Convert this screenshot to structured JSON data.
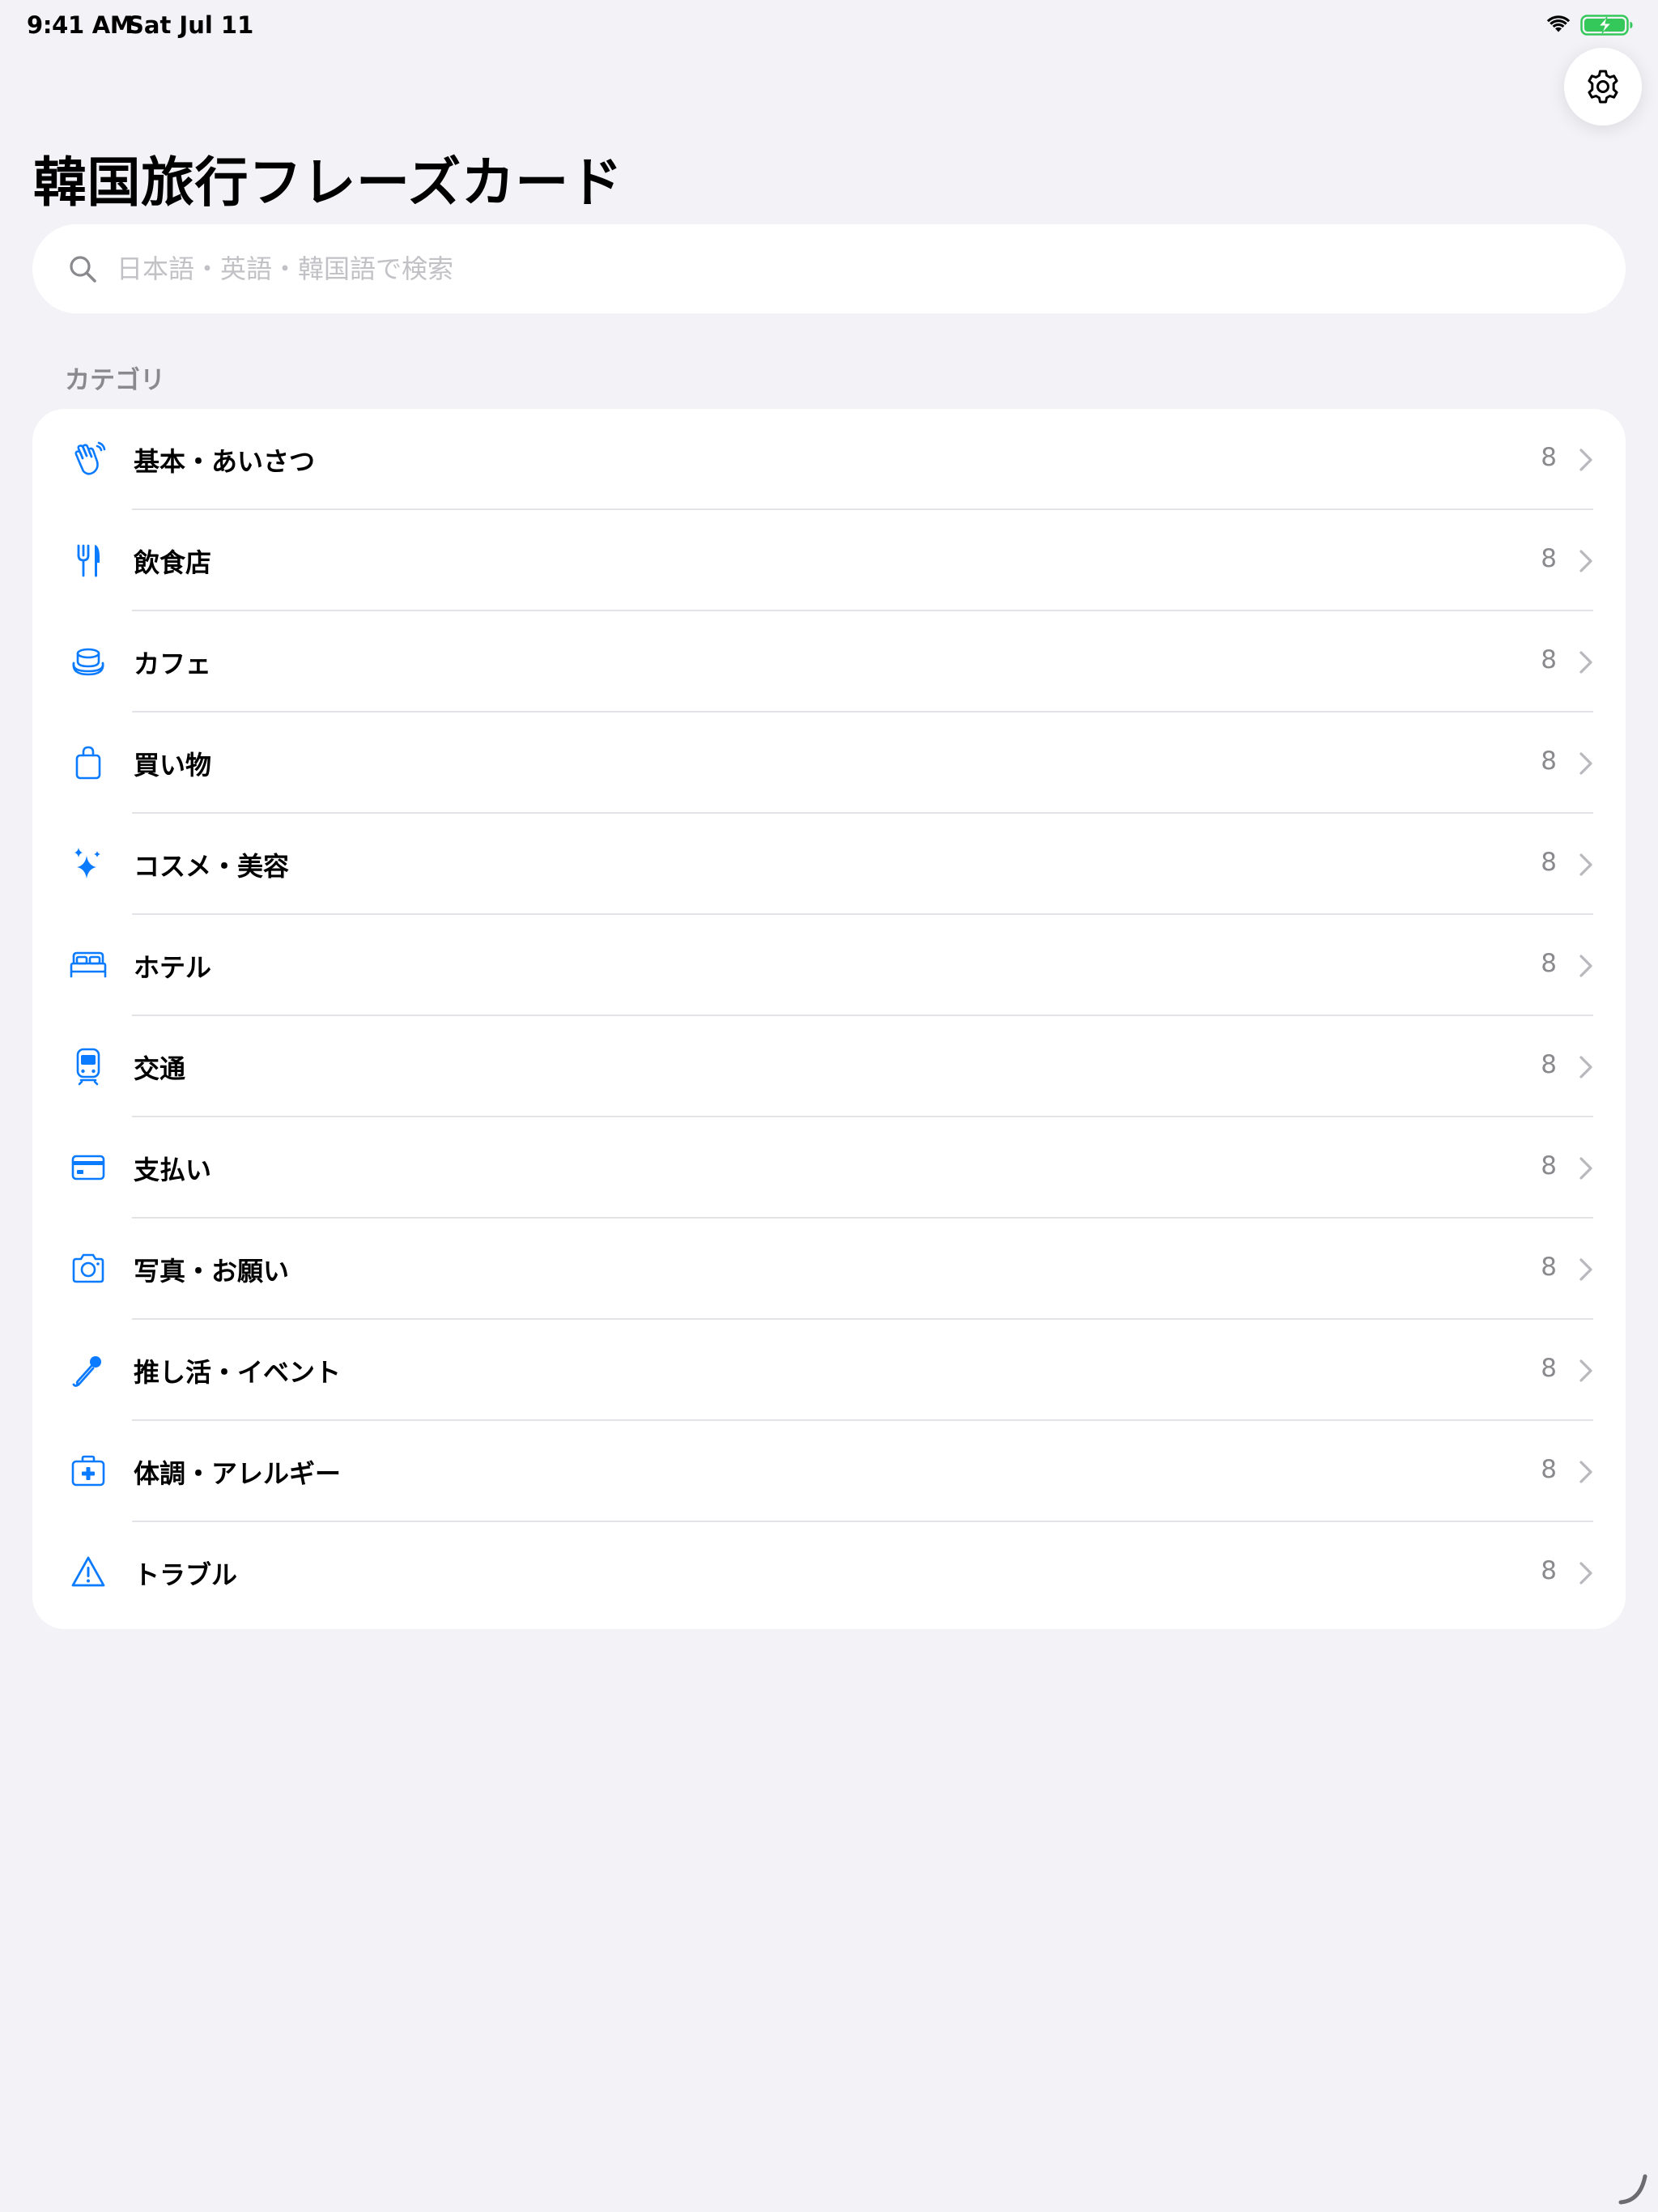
{
  "status_bar": {
    "time": "9:41 AM",
    "date": "Sat Jul 11"
  },
  "page_title": "韓国旅行フレーズカード",
  "search": {
    "placeholder": "日本語・英語・韓国語で検索",
    "value": ""
  },
  "section_header": "カテゴリ",
  "accent_color": "#0a7aff",
  "categories": [
    {
      "label": "基本・あいさつ",
      "count": "8",
      "icon": "hands-clapping-icon"
    },
    {
      "label": "飲食店",
      "count": "8",
      "icon": "fork-knife-icon"
    },
    {
      "label": "カフェ",
      "count": "8",
      "icon": "cup-saucer-icon"
    },
    {
      "label": "買い物",
      "count": "8",
      "icon": "shopping-bag-icon"
    },
    {
      "label": "コスメ・美容",
      "count": "8",
      "icon": "sparkles-icon"
    },
    {
      "label": "ホテル",
      "count": "8",
      "icon": "bed-icon"
    },
    {
      "label": "交通",
      "count": "8",
      "icon": "tram-icon"
    },
    {
      "label": "支払い",
      "count": "8",
      "icon": "credit-card-icon"
    },
    {
      "label": "写真・お願い",
      "count": "8",
      "icon": "camera-icon"
    },
    {
      "label": "推し活・イベント",
      "count": "8",
      "icon": "microphone-icon"
    },
    {
      "label": "体調・アレルギー",
      "count": "8",
      "icon": "medical-bag-icon"
    },
    {
      "label": "トラブル",
      "count": "8",
      "icon": "warning-triangle-icon"
    }
  ]
}
